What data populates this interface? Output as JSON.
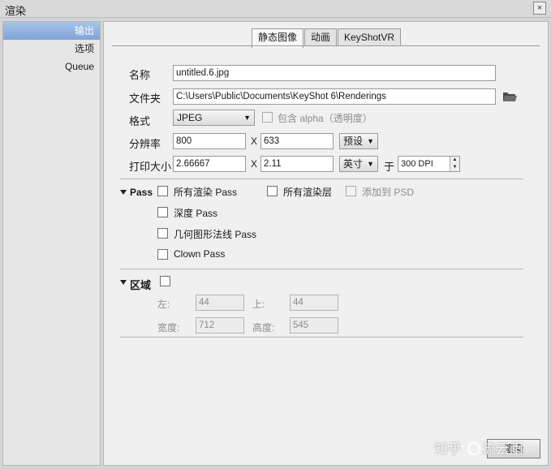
{
  "window": {
    "title": "渲染",
    "close_label": "×"
  },
  "sidebar": {
    "items": [
      {
        "label": "输出",
        "active": true
      },
      {
        "label": "选项",
        "active": false
      },
      {
        "label": "Queue",
        "active": false
      }
    ]
  },
  "tabs": [
    {
      "label": "静态图像",
      "active": true
    },
    {
      "label": "动画",
      "active": false
    },
    {
      "label": "KeyShotVR",
      "active": false
    }
  ],
  "output": {
    "name_label": "名称",
    "name_value": "untitled.6.jpg",
    "folder_label": "文件夹",
    "folder_value": "C:\\Users\\Public\\Documents\\KeyShot 6\\Renderings",
    "format_label": "格式",
    "format_value": "JPEG",
    "alpha_label": "包含 alpha（透明度）",
    "resolution_label": "分辨率",
    "res_width": "800",
    "x_symbol": "X",
    "res_height": "633",
    "preset_label": "预设",
    "print_size_label": "打印大小",
    "print_width": "2.66667",
    "print_height": "2.11",
    "unit_value": "英寸",
    "at_label": "于",
    "dpi_value": "300 DPI"
  },
  "pass": {
    "section_label": "Pass",
    "all_render_pass": "所有渲染 Pass",
    "all_render_layers": "所有渲染层",
    "add_to_psd": "添加到 PSD",
    "depth_pass": "深度 Pass",
    "normals_pass": "几何图形法线 Pass",
    "clown_pass": "Clown Pass"
  },
  "region": {
    "section_label": "区域",
    "left_label": "左:",
    "left_value": "44",
    "top_label": "上:",
    "top_value": "44",
    "width_label": "宽度:",
    "width_value": "712",
    "height_label": "高度:",
    "height_value": "545"
  },
  "footer": {
    "watermark_a": "知乎",
    "watermark_b": "流云雨",
    "render_button": "渲染"
  },
  "icons": {
    "folder": "folder-icon",
    "dropdown": "chevron-down-icon",
    "collapse": "triangle-down-icon"
  },
  "colors": {
    "accent": "#7fa3d8"
  }
}
